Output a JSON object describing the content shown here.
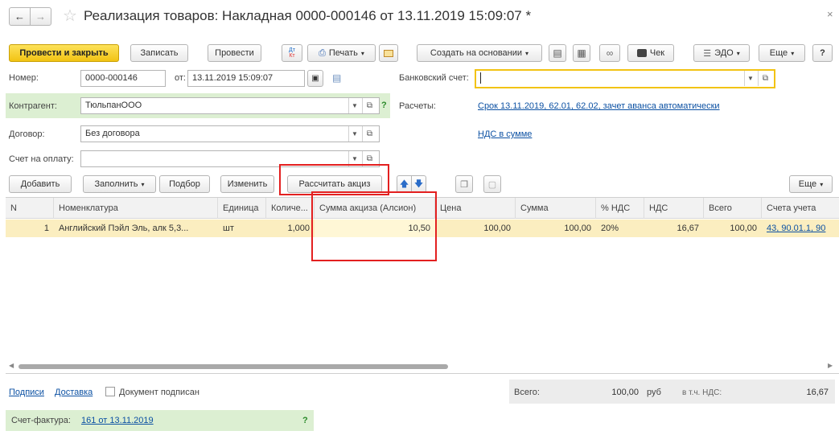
{
  "window": {
    "title": "Реализация товаров: Накладная 0000-000146 от 13.11.2019 15:09:07 *"
  },
  "toolbar": {
    "post_close": "Провести и закрыть",
    "save": "Записать",
    "post": "Провести",
    "dtkt": "Дт Кт",
    "print": "Печать",
    "create_based": "Создать на основании",
    "check": "Чек",
    "edo": "ЭДО",
    "more": "Еще",
    "help": "?"
  },
  "header": {
    "number_label": "Номер:",
    "number_value": "0000-000146",
    "date_label": "от:",
    "date_value": "13.11.2019 15:09:07",
    "bank_label": "Банковский счет:",
    "bank_value": "",
    "counterparty_label": "Контрагент:",
    "counterparty_value": "ТюльпанООО",
    "settlements_label": "Расчеты:",
    "settlements_link": "Срок 13.11.2019, 62.01, 62.02, зачет аванса автоматически",
    "contract_label": "Договор:",
    "contract_value": "Без договора",
    "vat_link": "НДС в сумме",
    "invoice_label": "Счет на оплату:",
    "invoice_value": ""
  },
  "table_toolbar": {
    "add": "Добавить",
    "fill": "Заполнить",
    "pick": "Подбор",
    "change": "Изменить",
    "calc_excise": "Рассчитать акциз",
    "more": "Еще"
  },
  "table": {
    "columns": [
      "N",
      "Номенклатура",
      "Единица",
      "Количе...",
      "Сумма акциза (Алсион)",
      "Цена",
      "Сумма",
      "% НДС",
      "НДС",
      "Всего",
      "Счета учета"
    ],
    "rows": [
      [
        "1",
        "Английский Пэйл Эль, алк 5,3...",
        "шт",
        "1,000",
        "10,50",
        "100,00",
        "100,00",
        "20%",
        "16,67",
        "100,00",
        "43, 90.01.1, 90"
      ]
    ]
  },
  "footer": {
    "signatures": "Подписи",
    "delivery": "Доставка",
    "signed_label": "Документ подписан",
    "total_label": "Всего:",
    "total_value": "100,00",
    "currency": "руб",
    "vat_label": "в т.ч. НДС:",
    "vat_value": "16,67",
    "invoice_doc_label": "Счет-фактура:",
    "invoice_doc_link": "161 от 13.11.2019",
    "help": "?"
  },
  "colors": {
    "accent_yellow": "#f2c313",
    "link": "#0c51a3",
    "green": "#dcefd2",
    "highlight": "#e32020",
    "row_selected": "#fbeec0"
  }
}
